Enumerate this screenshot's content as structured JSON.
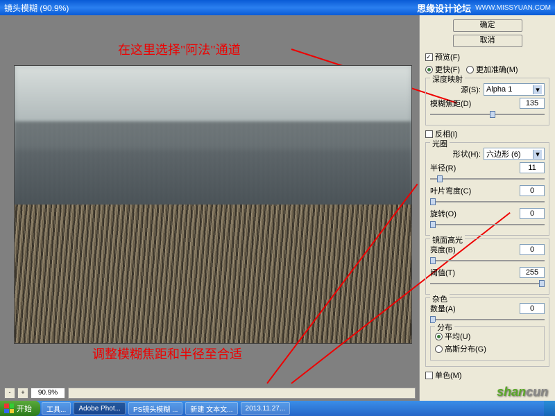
{
  "titlebar": {
    "title": "镜头模糊  (90.9%)",
    "brand": "思缘设计论坛",
    "url": "WWW.MISSYUAN.COM"
  },
  "annotations": {
    "top": "在这里选择\"阿法\"通道",
    "bottom": "调整模糊焦距和半径至合适"
  },
  "zoom": "90.9%",
  "buttons": {
    "ok": "确定",
    "cancel": "取消"
  },
  "preview": {
    "label": "预览(F)",
    "faster": "更快(F)",
    "accurate": "更加准确(M)"
  },
  "depth": {
    "title": "深度映射",
    "source_lbl": "源(S):",
    "source_val": "Alpha 1",
    "focal_lbl": "模糊焦距(D)",
    "focal_val": "135"
  },
  "invert": "反相(I)",
  "iris": {
    "title": "光圈",
    "shape_lbl": "形状(H):",
    "shape_val": "六边形 (6)",
    "radius_lbl": "半径(R)",
    "radius_val": "11",
    "curv_lbl": "叶片弯度(C)",
    "curv_val": "0",
    "rot_lbl": "旋转(O)",
    "rot_val": "0"
  },
  "spec": {
    "title": "镜面高光",
    "bright_lbl": "亮度(B)",
    "bright_val": "0",
    "thresh_lbl": "阈值(T)",
    "thresh_val": "255"
  },
  "noise": {
    "title": "杂色",
    "amount_lbl": "数量(A)",
    "amount_val": "0",
    "dist_title": "分布",
    "uniform": "平均(U)",
    "gaussian": "高斯分布(G)"
  },
  "mono": "单色(M)",
  "taskbar": {
    "start": "开始",
    "items": [
      "工具...",
      "Adobe Phot...",
      "PS镜头模糊 ...",
      "新建 文本文...",
      "2013.11.27..."
    ],
    "time": ""
  },
  "watermark": {
    "a": "shan",
    "b": "cun"
  }
}
